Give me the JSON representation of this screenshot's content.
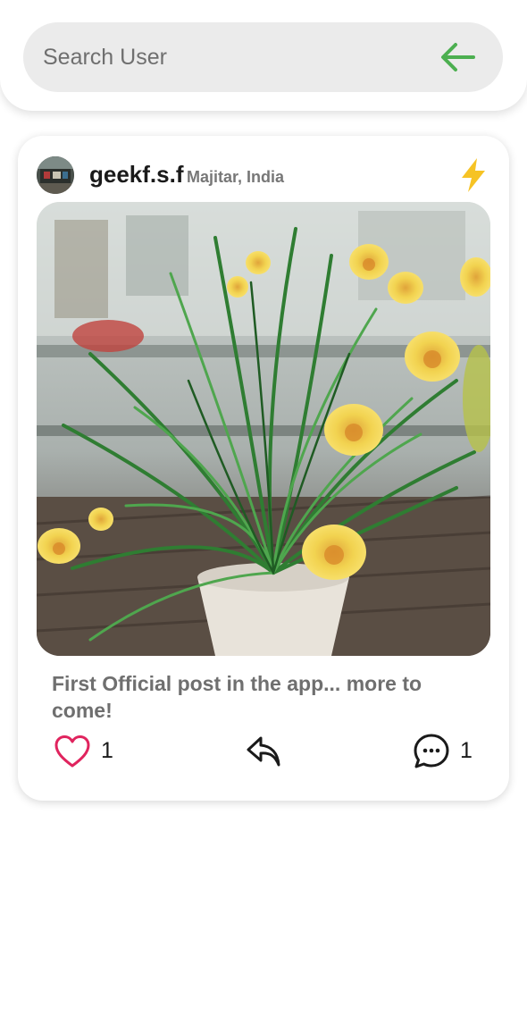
{
  "search": {
    "placeholder": "Search User"
  },
  "post": {
    "username": "geekf.s.f",
    "location": "Majitar, India",
    "caption": "First Official post in the app... more to come!",
    "likes": "1",
    "comments": "1"
  },
  "colors": {
    "accent_green": "#4caf50",
    "bolt_yellow": "#f6c325",
    "like_pink": "#e0245e"
  },
  "icons": {
    "back": "arrow-left-icon",
    "bolt": "lightning-bolt-icon",
    "like": "heart-outline-icon",
    "share": "reply-arrow-icon",
    "comment": "chat-bubble-dots-icon"
  }
}
